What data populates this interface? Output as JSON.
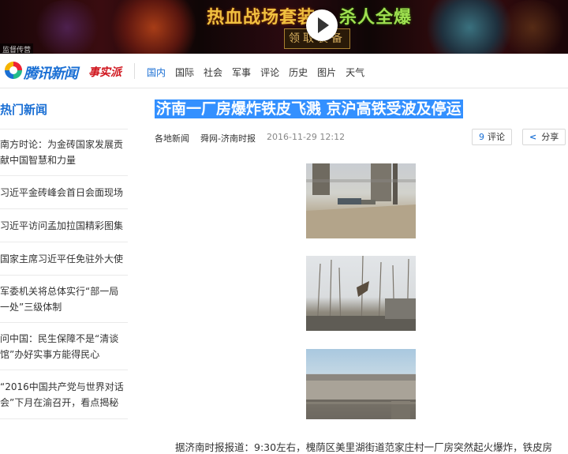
{
  "banner": {
    "text_left": "热血战场套装",
    "text_right": "杀人全爆",
    "text_sub": "领取装备",
    "ad_tag": "监督传营"
  },
  "header": {
    "site_name": "腾讯新闻",
    "site_sub": "事实派",
    "nav": [
      "国内",
      "国际",
      "社会",
      "军事",
      "评论",
      "历史",
      "图片",
      "天气"
    ],
    "active_nav": "国内"
  },
  "sidebar": {
    "title": "热门新闻",
    "items": [
      "南方时论：为金砖国家发展贡献中国智慧和力量",
      "习近平金砖峰会首日会面现场",
      "习近平访问孟加拉国精彩图集",
      "国家主席习近平任免驻外大使",
      "军委机关将总体实行“部一局一处”三级体制",
      "问中国：民生保障不是“清谈馆”办好实事方能得民心",
      "“2016中国共产党与世界对话会”下月在渝召开，看点揭秘"
    ]
  },
  "article": {
    "headline": "济南一厂房爆炸铁皮飞溅 京沪高铁受波及停运",
    "category": "各地新闻",
    "source": "舜网-济南时报",
    "time": "2016-11-29 12:12",
    "comment_count": "9",
    "comment_label": "评论",
    "share_label": "分享",
    "body": "据济南时报报道：9:30左右，槐荫区美里湖街道范家庄村一厂房突然起火爆炸，铁皮房"
  },
  "colors": {
    "accent": "#1a6fd4",
    "highlight": "#3390ff",
    "brand_red": "#d0161e"
  }
}
